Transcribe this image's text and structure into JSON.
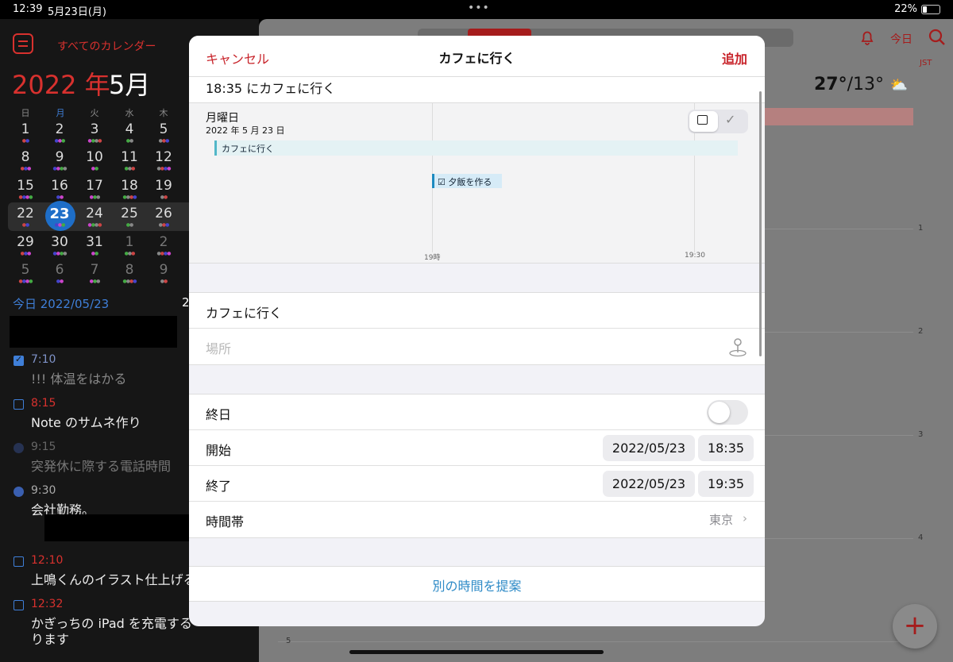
{
  "status": {
    "time": "12:39",
    "date": "5月23日(月)",
    "battery": "22%",
    "battery_level": 0.22
  },
  "sidebar": {
    "calendars_label": "すべてのカレンダー",
    "year": "2022 年",
    "month": "5月",
    "weekdays": [
      "日",
      "月",
      "火",
      "水",
      "木"
    ],
    "weeks": [
      [
        "1",
        "2",
        "3",
        "4",
        "5"
      ],
      [
        "8",
        "9",
        "10",
        "11",
        "12"
      ],
      [
        "15",
        "16",
        "17",
        "18",
        "19"
      ],
      [
        "22",
        "23",
        "24",
        "25",
        "26"
      ],
      [
        "29",
        "30",
        "31",
        "1",
        "2"
      ],
      [
        "5",
        "6",
        "7",
        "8",
        "9"
      ]
    ],
    "today_label": "今日 2022/05/23",
    "today_label2": "2",
    "tasks": [
      {
        "time": "7:10",
        "title": "!!! 体温をはかる"
      },
      {
        "time": "8:15",
        "title": "Note のサムネ作り"
      },
      {
        "time": "9:15",
        "title": "突発休に際する電話時間"
      },
      {
        "time": "9:30",
        "title": "会社勤務。"
      },
      {
        "time": "12:10",
        "title": "上鳴くんのイラスト仕上げる"
      },
      {
        "time": "12:32",
        "title": "かぎっちの iPad を充電する",
        "title2": "ります"
      }
    ]
  },
  "main": {
    "today_button": "今日",
    "timezone_badge": "JST",
    "weather_high": "27°",
    "weather_low": "/13°",
    "hours": [
      "1",
      "2",
      "3",
      "4",
      "5"
    ]
  },
  "modal": {
    "cancel": "キャンセル",
    "title": "カフェに行く",
    "add": "追加",
    "summary": "18:35 にカフェに行く",
    "timeline": {
      "day": "月曜日",
      "date": "2022 年 5 月 23 日",
      "event1": "カフェに行く",
      "event2": "☑ 夕飯を作る",
      "label1": "19時",
      "label2": "19:30"
    },
    "event_title": "カフェに行く",
    "location_placeholder": "場所",
    "all_day_label": "終日",
    "start_label": "開始",
    "start_date": "2022/05/23",
    "start_time": "18:35",
    "end_label": "終了",
    "end_date": "2022/05/23",
    "end_time": "19:35",
    "timezone_label": "時間帯",
    "timezone_value": "東京",
    "suggest_label": "別の時間を提案"
  }
}
